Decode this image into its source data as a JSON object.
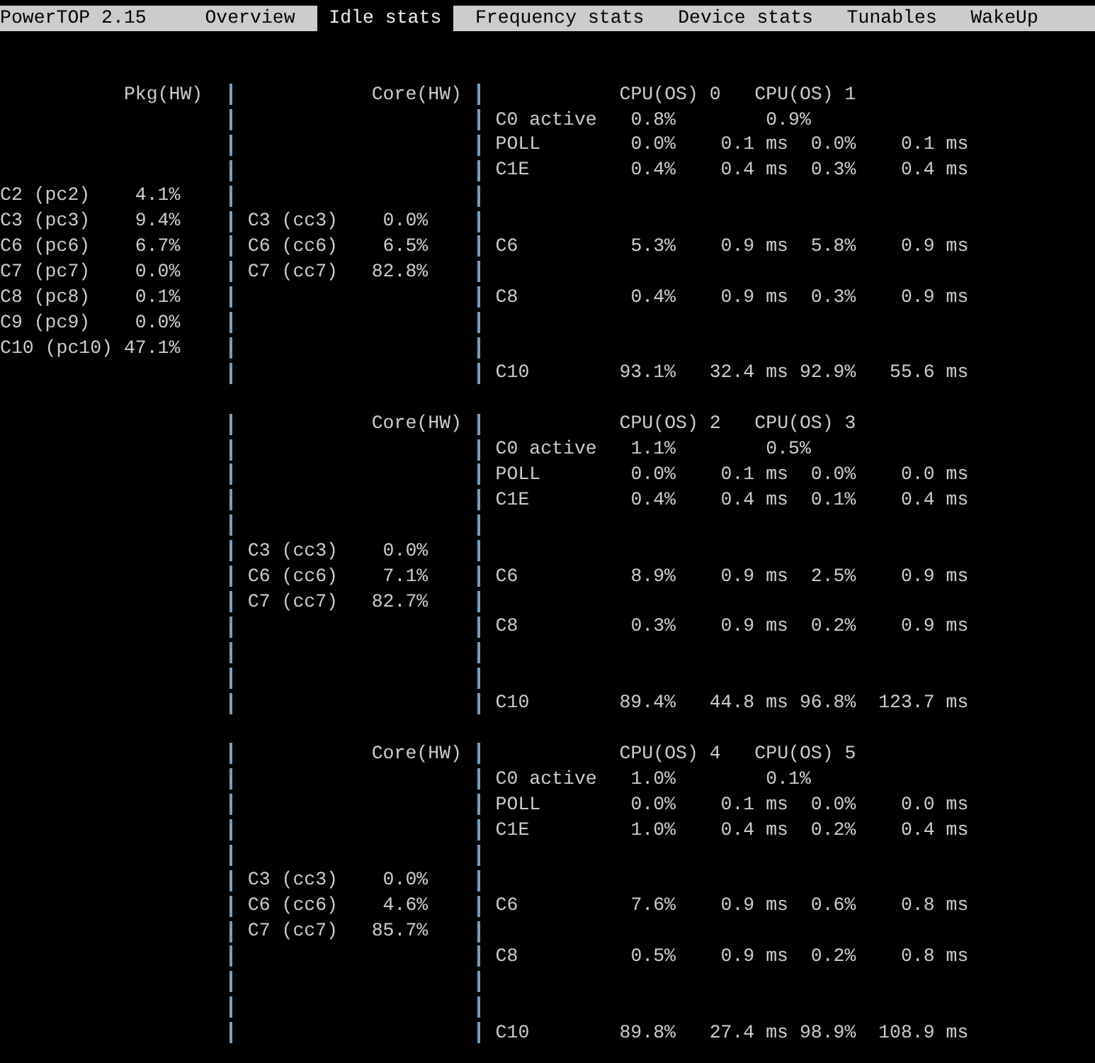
{
  "tab_bar": {
    "title": "PowerTOP 2.15",
    "tabs": [
      {
        "label": "Overview",
        "selected": false
      },
      {
        "label": "Idle stats",
        "selected": true
      },
      {
        "label": "Frequency stats",
        "selected": false
      },
      {
        "label": "Device stats",
        "selected": false
      },
      {
        "label": "Tunables",
        "selected": false
      },
      {
        "label": "WakeUp",
        "selected": false
      }
    ]
  },
  "groups": [
    {
      "pkg_heading": "Pkg(HW)",
      "core_heading": "Core(HW)",
      "cpu_headings": [
        "CPU(OS) 0",
        "CPU(OS) 1"
      ],
      "lines": [
        {
          "kind": "states",
          "cpu": {
            "state": "C0 active",
            "kind": "active",
            "values": [
              {
                "usage": "0.8%"
              },
              {
                "usage": "0.9%"
              }
            ]
          }
        },
        {
          "kind": "states",
          "cpu": {
            "state": "POLL",
            "kind": "idle",
            "values": [
              {
                "usage": "0.0%",
                "duration": "0.1 ms"
              },
              {
                "usage": "0.0%",
                "duration": "0.1 ms"
              }
            ]
          }
        },
        {
          "kind": "states",
          "cpu": {
            "state": "C1E",
            "kind": "idle",
            "values": [
              {
                "usage": "0.4%",
                "duration": "0.4 ms"
              },
              {
                "usage": "0.3%",
                "duration": "0.4 ms"
              }
            ]
          }
        },
        {
          "kind": "states",
          "pkg": {
            "state": "C2 (pc2)",
            "usage": "4.1%"
          }
        },
        {
          "kind": "states",
          "pkg": {
            "state": "C3 (pc3)",
            "usage": "9.4%"
          },
          "core": {
            "state": "C3 (cc3)",
            "usage": "0.0%"
          }
        },
        {
          "kind": "states",
          "pkg": {
            "state": "C6 (pc6)",
            "usage": "6.7%"
          },
          "core": {
            "state": "C6 (cc6)",
            "usage": "6.5%"
          },
          "cpu": {
            "state": "C6",
            "kind": "idle",
            "values": [
              {
                "usage": "5.3%",
                "duration": "0.9 ms"
              },
              {
                "usage": "5.8%",
                "duration": "0.9 ms"
              }
            ]
          }
        },
        {
          "kind": "states",
          "pkg": {
            "state": "C7 (pc7)",
            "usage": "0.0%"
          },
          "core": {
            "state": "C7 (cc7)",
            "usage": "82.8%"
          }
        },
        {
          "kind": "states",
          "pkg": {
            "state": "C8 (pc8)",
            "usage": "0.1%"
          },
          "cpu": {
            "state": "C8",
            "kind": "idle",
            "values": [
              {
                "usage": "0.4%",
                "duration": "0.9 ms"
              },
              {
                "usage": "0.3%",
                "duration": "0.9 ms"
              }
            ]
          }
        },
        {
          "kind": "states",
          "pkg": {
            "state": "C9 (pc9)",
            "usage": "0.0%"
          }
        },
        {
          "kind": "states",
          "pkg": {
            "state": "C10 (pc10)",
            "usage": "47.1%"
          }
        },
        {
          "kind": "states",
          "cpu": {
            "state": "C10",
            "kind": "idle",
            "values": [
              {
                "usage": "93.1%",
                "duration": "32.4 ms"
              },
              {
                "usage": "92.9%",
                "duration": "55.6 ms"
              }
            ]
          }
        }
      ]
    },
    {
      "core_heading": "Core(HW)",
      "cpu_headings": [
        "CPU(OS) 2",
        "CPU(OS) 3"
      ],
      "lines": [
        {
          "kind": "states",
          "cpu": {
            "state": "C0 active",
            "kind": "active",
            "values": [
              {
                "usage": "1.1%"
              },
              {
                "usage": "0.5%"
              }
            ]
          }
        },
        {
          "kind": "states",
          "cpu": {
            "state": "POLL",
            "kind": "idle",
            "values": [
              {
                "usage": "0.0%",
                "duration": "0.1 ms"
              },
              {
                "usage": "0.0%",
                "duration": "0.0 ms"
              }
            ]
          }
        },
        {
          "kind": "states",
          "cpu": {
            "state": "C1E",
            "kind": "idle",
            "values": [
              {
                "usage": "0.4%",
                "duration": "0.4 ms"
              },
              {
                "usage": "0.1%",
                "duration": "0.4 ms"
              }
            ]
          }
        },
        {
          "kind": "blank"
        },
        {
          "kind": "states",
          "core": {
            "state": "C3 (cc3)",
            "usage": "0.0%"
          }
        },
        {
          "kind": "states",
          "core": {
            "state": "C6 (cc6)",
            "usage": "7.1%"
          },
          "cpu": {
            "state": "C6",
            "kind": "idle",
            "values": [
              {
                "usage": "8.9%",
                "duration": "0.9 ms"
              },
              {
                "usage": "2.5%",
                "duration": "0.9 ms"
              }
            ]
          }
        },
        {
          "kind": "states",
          "core": {
            "state": "C7 (cc7)",
            "usage": "82.7%"
          }
        },
        {
          "kind": "states",
          "cpu": {
            "state": "C8",
            "kind": "idle",
            "values": [
              {
                "usage": "0.3%",
                "duration": "0.9 ms"
              },
              {
                "usage": "0.2%",
                "duration": "0.9 ms"
              }
            ]
          }
        },
        {
          "kind": "blank"
        },
        {
          "kind": "blank"
        },
        {
          "kind": "states",
          "cpu": {
            "state": "C10",
            "kind": "idle",
            "values": [
              {
                "usage": "89.4%",
                "duration": "44.8 ms"
              },
              {
                "usage": "96.8%",
                "duration": "123.7 ms"
              }
            ]
          }
        }
      ]
    },
    {
      "core_heading": "Core(HW)",
      "cpu_headings": [
        "CPU(OS) 4",
        "CPU(OS) 5"
      ],
      "lines": [
        {
          "kind": "states",
          "cpu": {
            "state": "C0 active",
            "kind": "active",
            "values": [
              {
                "usage": "1.0%"
              },
              {
                "usage": "0.1%"
              }
            ]
          }
        },
        {
          "kind": "states",
          "cpu": {
            "state": "POLL",
            "kind": "idle",
            "values": [
              {
                "usage": "0.0%",
                "duration": "0.1 ms"
              },
              {
                "usage": "0.0%",
                "duration": "0.0 ms"
              }
            ]
          }
        },
        {
          "kind": "states",
          "cpu": {
            "state": "C1E",
            "kind": "idle",
            "values": [
              {
                "usage": "1.0%",
                "duration": "0.4 ms"
              },
              {
                "usage": "0.2%",
                "duration": "0.4 ms"
              }
            ]
          }
        },
        {
          "kind": "blank"
        },
        {
          "kind": "states",
          "core": {
            "state": "C3 (cc3)",
            "usage": "0.0%"
          }
        },
        {
          "kind": "states",
          "core": {
            "state": "C6 (cc6)",
            "usage": "4.6%"
          },
          "cpu": {
            "state": "C6",
            "kind": "idle",
            "values": [
              {
                "usage": "7.6%",
                "duration": "0.9 ms"
              },
              {
                "usage": "0.6%",
                "duration": "0.8 ms"
              }
            ]
          }
        },
        {
          "kind": "states",
          "core": {
            "state": "C7 (cc7)",
            "usage": "85.7%"
          }
        },
        {
          "kind": "states",
          "cpu": {
            "state": "C8",
            "kind": "idle",
            "values": [
              {
                "usage": "0.5%",
                "duration": "0.9 ms"
              },
              {
                "usage": "0.2%",
                "duration": "0.8 ms"
              }
            ]
          }
        },
        {
          "kind": "blank"
        },
        {
          "kind": "blank"
        },
        {
          "kind": "states",
          "cpu": {
            "state": "C10",
            "kind": "idle",
            "values": [
              {
                "usage": "89.8%",
                "duration": "27.4 ms"
              },
              {
                "usage": "98.9%",
                "duration": "108.9 ms"
              }
            ]
          }
        }
      ]
    }
  ]
}
